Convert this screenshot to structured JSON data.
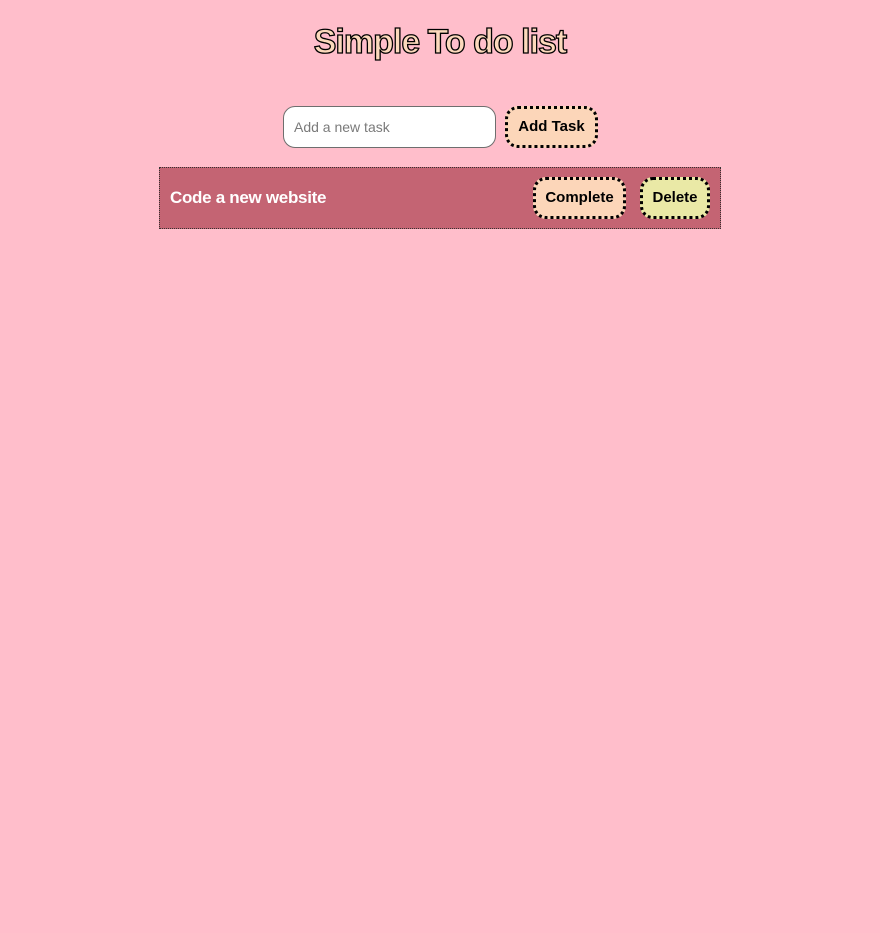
{
  "header": {
    "title": "Simple To do list"
  },
  "add_form": {
    "input_value": "",
    "input_placeholder": "Add a new task",
    "add_button_label": "Add Task"
  },
  "tasks": [
    {
      "text": "Code a new website",
      "complete_label": "Complete",
      "delete_label": "Delete"
    }
  ],
  "colors": {
    "background": "#ffbecb",
    "task_row": "#c46473",
    "title_fill": "#fcd9bc",
    "add_button": "#fcd6b9",
    "complete_button": "#fcd6b9",
    "delete_button": "#eae9a6"
  }
}
